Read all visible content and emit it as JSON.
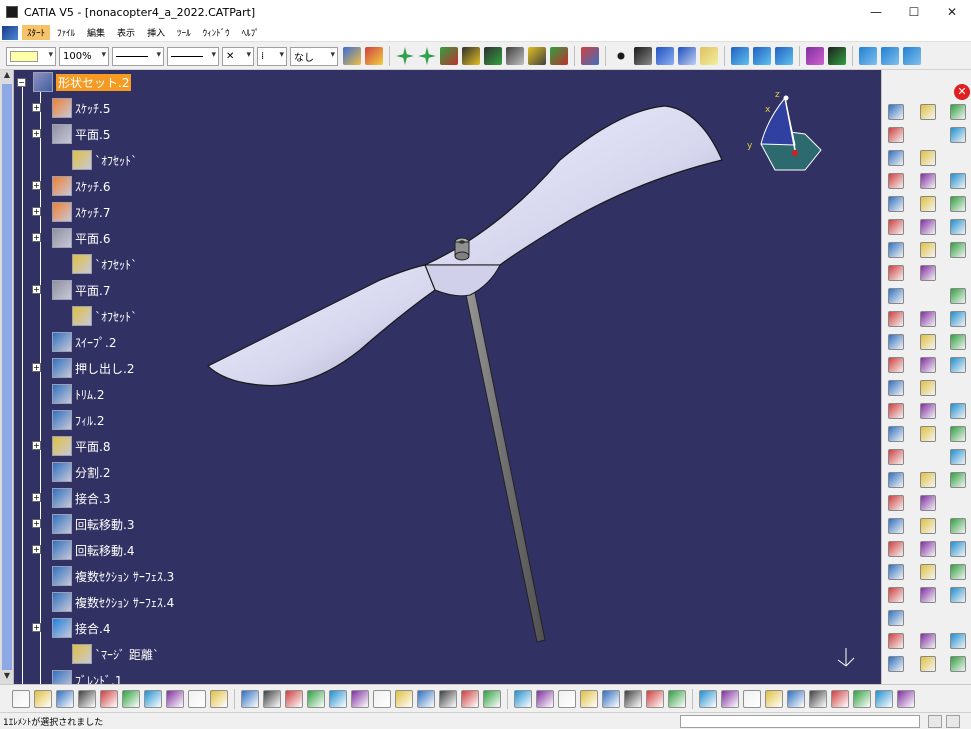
{
  "window": {
    "title": "CATIA V5 - [nonacopter4_a_2022.CATPart]",
    "minimize": "—",
    "maximize": "☐",
    "close": "✕"
  },
  "menu": {
    "items": [
      {
        "label": "ｽﾀｰﾄ",
        "active": true
      },
      {
        "label": "ﾌｧｲﾙ"
      },
      {
        "label": "編集"
      },
      {
        "label": "表示"
      },
      {
        "label": "挿入"
      },
      {
        "label": "ﾂｰﾙ"
      },
      {
        "label": "ｳｨﾝﾄﾞｳ"
      },
      {
        "label": "ﾍﾙﾌﾟ"
      }
    ]
  },
  "toolbar": {
    "zoom_value": "100%",
    "thickness_value": "⁞",
    "layer_value": "なし",
    "pick_value": "✕"
  },
  "tree": {
    "root": "形状セット.2",
    "items": [
      {
        "label": "ｽｹｯﾁ.5"
      },
      {
        "label": "平面.5"
      },
      {
        "label": "`ｵﾌｾｯﾄ`"
      },
      {
        "label": "ｽｹｯﾁ.6"
      },
      {
        "label": "ｽｹｯﾁ.7"
      },
      {
        "label": "平面.6"
      },
      {
        "label": "`ｵﾌｾｯﾄ`"
      },
      {
        "label": "平面.7"
      },
      {
        "label": "`ｵﾌｾｯﾄ`"
      },
      {
        "label": "ｽｲｰﾌﾟ.2"
      },
      {
        "label": "押し出し.2"
      },
      {
        "label": "ﾄﾘﾑ.2"
      },
      {
        "label": "ﾌｨﾙ.2"
      },
      {
        "label": "平面.8"
      },
      {
        "label": "分割.2"
      },
      {
        "label": "接合.3"
      },
      {
        "label": "回転移動.3"
      },
      {
        "label": "回転移動.4"
      },
      {
        "label": "複数ｾｸｼｮﾝ ｻｰﾌｪｽ.3"
      },
      {
        "label": "複数ｾｸｼｮﾝ ｻｰﾌｪｽ.4"
      },
      {
        "label": "接合.4"
      },
      {
        "label": "`ﾏｰｼﾞ 距離`"
      },
      {
        "label": "ﾌﾞﾚﾝﾄﾞ.1"
      }
    ]
  },
  "compass": {
    "x": "x",
    "y": "y",
    "z": "z"
  },
  "status": {
    "message": "1ｴﾚﾒﾝﾄが選択されました"
  },
  "colors": {
    "viewport_bg": "#313163",
    "part_fill": "#d8d8f0",
    "selection": "#f59a23"
  }
}
